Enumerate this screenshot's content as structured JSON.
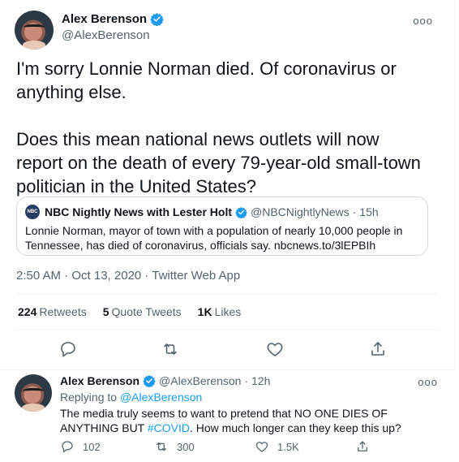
{
  "tweet": {
    "author": {
      "name": "Alex Berenson",
      "handle": "@AlexBerenson",
      "verified": true
    },
    "more_label": "ooo",
    "text": "I'm sorry Lonnie Norman died. Of coronavirus or anything else.\n\nDoes this mean national news outlets will now report on the death of every 79-year-old small-town politician in the United States?",
    "quote": {
      "avatar_text": "NBC NEWS",
      "name": "NBC Nightly News with Lester Holt",
      "verified": true,
      "handle": "@NBCNightlyNews",
      "separator": "·",
      "time": "15h",
      "text": "Lonnie Norman, mayor of town with a population of nearly 10,000 people in Tennessee, has died of coronavirus, officials say. nbcnews.to/3lEPBIh"
    },
    "timestamp": "2:50 AM · Oct 13, 2020",
    "meta_separator": "·",
    "source": "Twitter Web App",
    "stats": {
      "retweets_count": "224",
      "retweets_label": "Retweets",
      "quotes_count": "5",
      "quotes_label": "Quote Tweets",
      "likes_count": "1K",
      "likes_label": "Likes"
    }
  },
  "reply": {
    "author": {
      "name": "Alex Berenson",
      "handle": "@AlexBerenson",
      "verified": true
    },
    "separator": "·",
    "time": "12h",
    "more_label": "ooo",
    "replying_prefix": "Replying to",
    "replying_handle": "@AlexBerenson",
    "text_before_hashtag": "The media truly seems to want to pretend that NO ONE DIES OF ANYTHING BUT ",
    "hashtag": "#COVID",
    "text_after_hashtag": ". How much longer can they keep this up?",
    "actions": {
      "replies": "102",
      "retweets": "300",
      "likes": "1.5K"
    }
  },
  "colors": {
    "accent": "#1d9bf0",
    "secondary_text": "#536471",
    "border": "#cfd9de",
    "divider": "#eff3f4"
  },
  "icons": [
    "verified-badge-icon",
    "more-icon",
    "reply-icon",
    "retweet-icon",
    "like-icon",
    "share-icon"
  ]
}
